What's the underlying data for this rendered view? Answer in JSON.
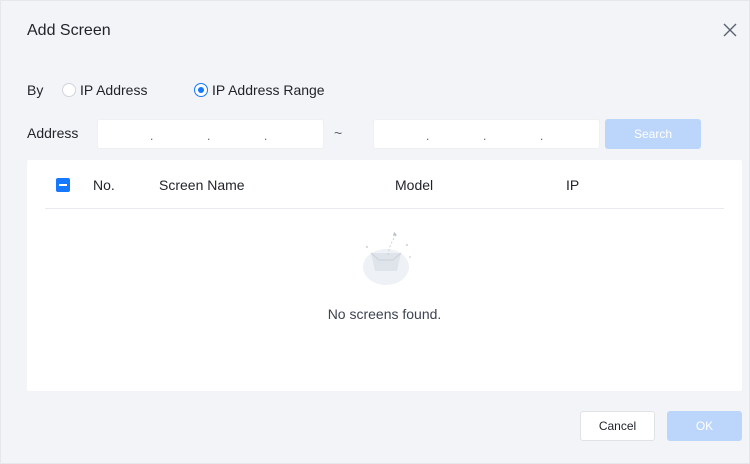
{
  "dialog": {
    "title": "Add Screen",
    "close_icon": "close-icon"
  },
  "by": {
    "label": "By",
    "options": [
      {
        "label": "IP Address",
        "checked": false
      },
      {
        "label": "IP Address Range",
        "checked": true
      }
    ]
  },
  "address": {
    "label": "Address",
    "from_value": ". . .",
    "separator": "~",
    "to_value": ". . .",
    "search_label": "Search"
  },
  "table": {
    "select_all_state": "indeterminate",
    "columns": [
      "No.",
      "Screen Name",
      "Model",
      "IP"
    ],
    "rows": [],
    "empty_icon": "empty-box-icon",
    "empty_text": "No screens found."
  },
  "footer": {
    "cancel_label": "Cancel",
    "ok_label": "OK"
  },
  "colors": {
    "accent": "#1677ff",
    "disabled_button": "#bcd6fb",
    "background": "#f2f4f7"
  }
}
